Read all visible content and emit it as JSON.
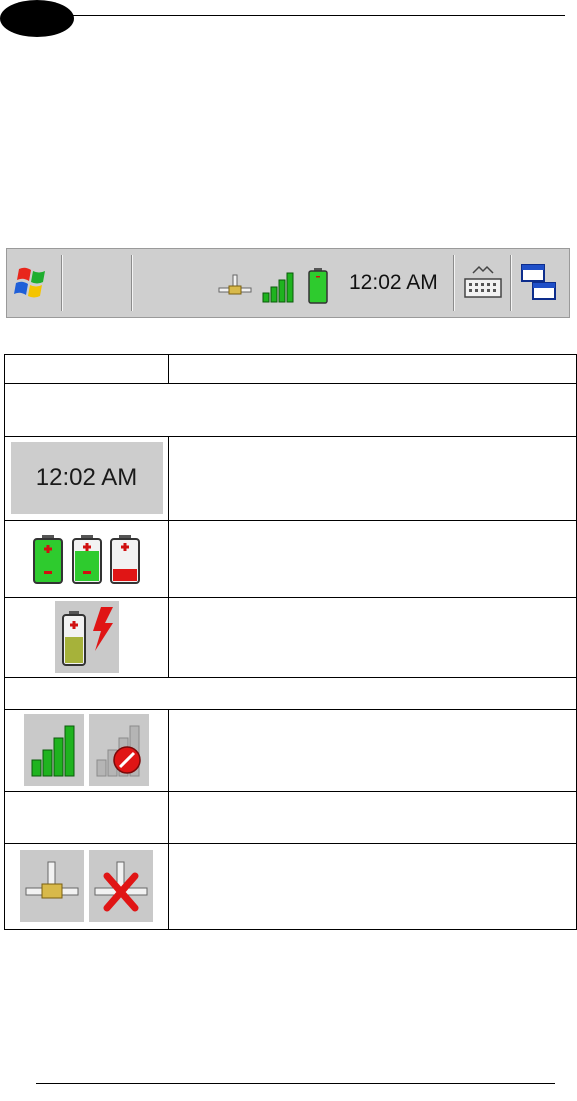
{
  "taskbar": {
    "start_icon": "windows-flag-icon",
    "tray_icons": [
      "network-connected-icon",
      "signal-strength-icon",
      "battery-icon"
    ],
    "clock": "12:02 AM",
    "keyboard_icon": "input-panel-keyboard-icon",
    "windows_icon": "task-switch-icon"
  },
  "table": {
    "clock_example": "12:02 AM",
    "battery_icons": [
      "battery-high-icon",
      "battery-medium-icon",
      "battery-low-icon"
    ],
    "charging_icon": "battery-charging-icon",
    "signal_icons": [
      "signal-strength-icon",
      "signal-unavailable-icon"
    ],
    "network_icons": [
      "network-connected-icon",
      "network-disconnected-icon"
    ]
  },
  "colors": {
    "taskbar_bg": "#cfcfcf",
    "battery_green": "#2ecb2e",
    "battery_red": "#e01515",
    "signal_green": "#1fb31f"
  }
}
